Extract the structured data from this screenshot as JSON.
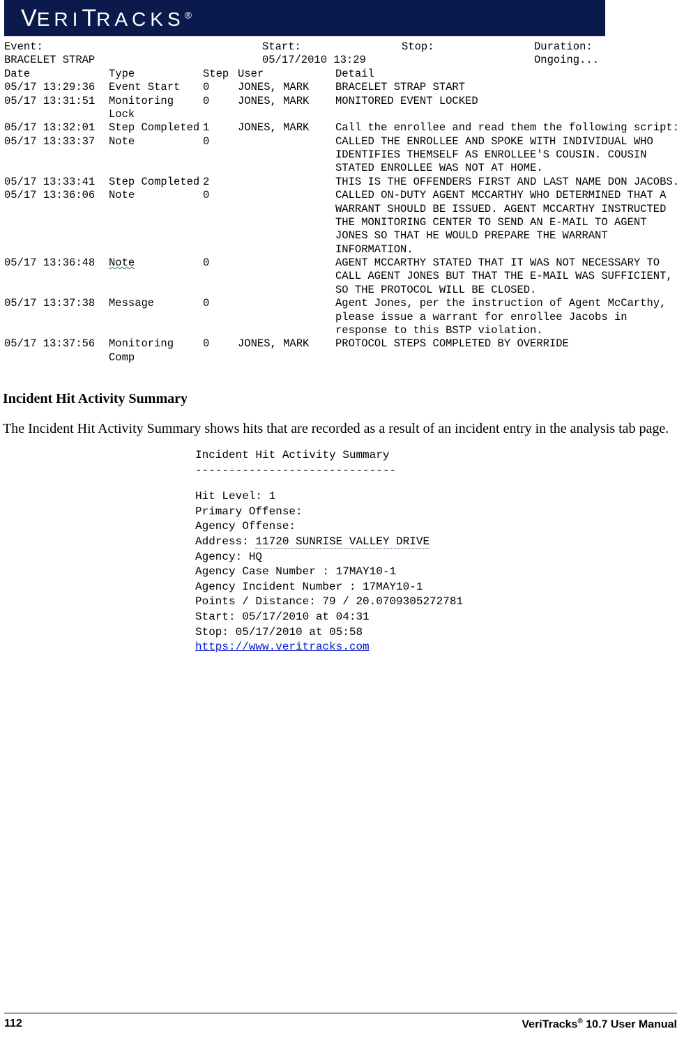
{
  "header": {
    "logo_text": "VERITRACKS®"
  },
  "event_header": {
    "labels": {
      "event": "Event:",
      "start": "Start:",
      "stop": "Stop:",
      "duration": "Duration:"
    },
    "values": {
      "event": "BRACELET STRAP",
      "start": "05/17/2010 13:29",
      "stop": "",
      "duration": "Ongoing..."
    }
  },
  "columns": {
    "date": "Date",
    "type": "Type",
    "step": "Step",
    "user": "User",
    "detail": "Detail"
  },
  "rows": [
    {
      "date": "05/17 13:29:36",
      "type": "Event Start",
      "step": "0",
      "user": "JONES, MARK",
      "detail": "BRACELET STRAP START"
    },
    {
      "date": "05/17 13:31:51",
      "type": "Monitoring Lock",
      "step": "0",
      "user": "JONES, MARK",
      "detail": "MONITORED EVENT LOCKED"
    },
    {
      "date": "05/17 13:32:01",
      "type": "Step Completed",
      "step": "1",
      "user": "JONES, MARK",
      "detail": "Call the enrollee and read them the following script:"
    },
    {
      "date": "05/17 13:33:37",
      "type": "Note",
      "step": "0",
      "user": "",
      "detail": "CALLED THE ENROLLEE AND SPOKE WITH INDIVIDUAL WHO IDENTIFIES THEMSELF AS ENROLLEE'S COUSIN. COUSIN STATED ENROLLEE WAS NOT AT HOME."
    },
    {
      "date": "05/17 13:33:41",
      "type": "Step Completed",
      "step": "2",
      "user": "",
      "detail": "THIS IS THE OFFENDERS FIRST AND LAST NAME DON JACOBS."
    },
    {
      "date": "05/17 13:36:06",
      "type": "Note",
      "step": "0",
      "user": "",
      "detail": "CALLED ON-DUTY AGENT MCCARTHY WHO DETERMINED THAT A WARRANT SHOULD BE ISSUED. AGENT MCCARTHY INSTRUCTED THE MONITORING CENTER TO SEND AN E-MAIL TO AGENT JONES SO THAT HE WOULD PREPARE THE WARRANT INFORMATION."
    },
    {
      "date": "05/17 13:36:48",
      "type": "Note",
      "type_underline": true,
      "step": "0",
      "user": "",
      "detail": "AGENT MCCARTHY STATED THAT IT WAS NOT NECESSARY TO CALL AGENT JONES BUT THAT THE E-MAIL WAS SUFFICIENT, SO THE PROTOCOL WILL BE CLOSED."
    },
    {
      "date": "05/17 13:37:38",
      "type": "Message",
      "step": "0",
      "user": "",
      "detail": "Agent Jones, per the instruction of Agent McCarthy, please issue a warrant for enrollee Jacobs in response to this BSTP violation."
    },
    {
      "date": "05/17 13:37:56",
      "type": "Monitoring Comp",
      "step": "0",
      "user": "JONES, MARK",
      "detail": "PROTOCOL STEPS COMPLETED BY OVERRIDE"
    }
  ],
  "section": {
    "heading": "Incident Hit Activity Summary",
    "body": "The Incident Hit Activity Summary shows hits that are recorded as a result of an incident entry in the analysis tab page."
  },
  "incident": {
    "title": "Incident Hit Activity Summary",
    "sep": "------------------------------",
    "hit_level": "Hit Level: 1",
    "primary_offense": "Primary Offense:",
    "agency_offense": "Agency Offense:",
    "address_label": "Address: ",
    "address_value": "11720 SUNRISE VALLEY DRIVE",
    "agency": "Agency: HQ",
    "case_number": "Agency Case Number : 17MAY10-1",
    "incident_number": "Agency Incident Number : 17MAY10-1",
    "points_distance": "Points / Distance: 79 / 20.0709305272781",
    "start": "Start: 05/17/2010 at 04:31",
    "stop": "Stop: 05/17/2010 at 05:58",
    "link": "https://www.veritracks.com"
  },
  "footer": {
    "page": "112",
    "product": "VeriTracks",
    "reg": "®",
    "suffix": " 10.7 User Manual"
  }
}
